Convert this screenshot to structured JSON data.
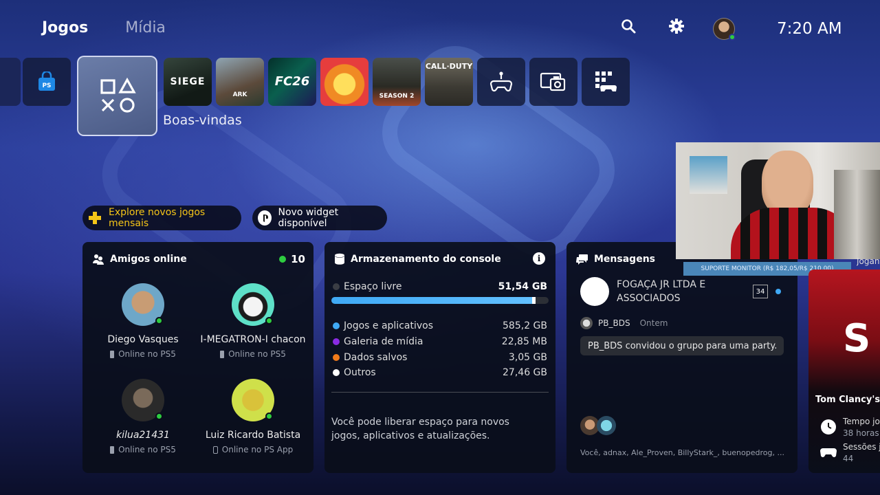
{
  "nav": {
    "tabs": [
      {
        "label": "Jogos"
      },
      {
        "label": "Mídia"
      }
    ]
  },
  "clock": "7:20 AM",
  "games_row": {
    "tiles": [
      {
        "name": "Rainbow Six Siege",
        "label": "SIEGE"
      },
      {
        "name": "ARK",
        "label": "ARK"
      },
      {
        "name": "EA FC 26",
        "label": "FC26"
      },
      {
        "name": "Cozy game",
        "label": ""
      },
      {
        "name": "Call of Duty Season 2",
        "label": "SEASON 2"
      },
      {
        "name": "Call of Duty",
        "label": "CALL·DUTY"
      }
    ],
    "hub_caption": "Boas-vindas"
  },
  "pills": {
    "explore": "Explore novos jogos mensais",
    "widget": "Novo widget disponível"
  },
  "friends": {
    "title": "Amigos online",
    "count": "10",
    "list": [
      {
        "name": "Diego Vasques",
        "status": "Online no PS5"
      },
      {
        "name": "I-MEGATRON-I chacon",
        "status": "Online no PS5"
      },
      {
        "name": "kilua21431",
        "status": "Online no PS5"
      },
      {
        "name": "Luiz Ricardo Batista",
        "status": "Online no PS App"
      }
    ]
  },
  "storage": {
    "title": "Armazenamento do console",
    "free_label": "Espaço livre",
    "free_value": "51,54 GB",
    "used_fraction": 0.94,
    "items": [
      {
        "label": "Jogos e aplicativos",
        "value": "585,2 GB",
        "color": "#3fa9f5"
      },
      {
        "label": "Galeria de mídia",
        "value": "22,85 MB",
        "color": "#8a2be2"
      },
      {
        "label": "Dados salvos",
        "value": "3,05 GB",
        "color": "#f07a1a"
      },
      {
        "label": "Outros",
        "value": "27,46 GB",
        "color": "#ffffff"
      }
    ],
    "note": "Você pode liberar espaço para novos jogos, aplicativos e atualizações."
  },
  "messages": {
    "title": "Mensagens",
    "group_name": "FOGAÇA JR LTDA E ASSOCIADOS",
    "unread": "34",
    "sender": "PB_BDS",
    "time": "Ontem",
    "bubble": "PB_BDS convidou o grupo para uma party.",
    "members": "Você, adnax, Ale_Proven, BillyStark_, buenopedrog, ..."
  },
  "side_card": {
    "title": "Tom Clancy's F",
    "time_label": "Tempo jo",
    "time_value": "38 horas",
    "sessions_label": "Sessões jo",
    "sessions_value": "44"
  },
  "overlay": {
    "banner": "SUPORTE MONITOR (R$ 182,05/R$ 210,00)",
    "partial_text": "Jogando r"
  }
}
